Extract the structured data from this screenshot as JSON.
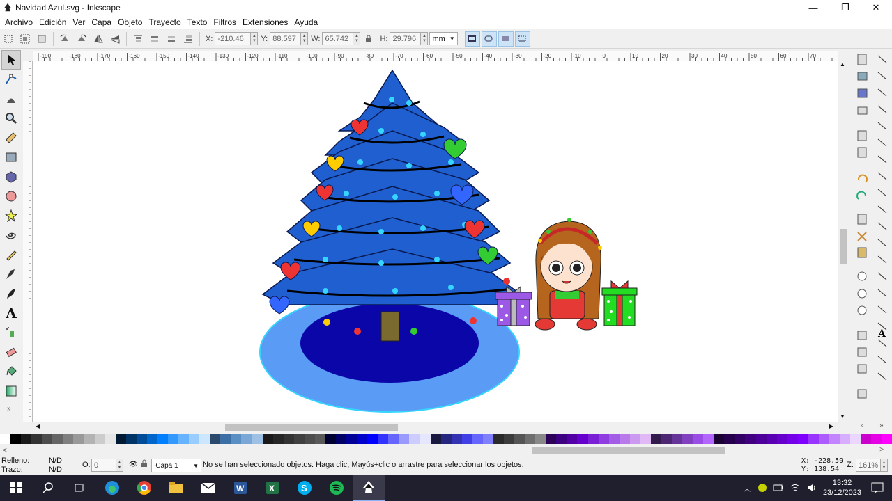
{
  "window": {
    "title": "Navidad Azul.svg - Inkscape",
    "minimize": "—",
    "maximize": "❐",
    "close": "✕"
  },
  "menu": [
    "Archivo",
    "Edición",
    "Ver",
    "Capa",
    "Objeto",
    "Trayecto",
    "Texto",
    "Filtros",
    "Extensiones",
    "Ayuda"
  ],
  "controls": {
    "x_label": "X:",
    "x_value": "-210.46",
    "y_label": "Y:",
    "y_value": "88.597",
    "w_label": "W:",
    "w_value": "65.742",
    "h_label": "H:",
    "h_value": "29.796",
    "unit": "mm"
  },
  "ruler_labels": [
    "-190",
    "-180",
    "-170",
    "-160",
    "-150",
    "-140",
    "-130",
    "-120",
    "-110",
    "-100",
    "-90",
    "-80",
    "-70",
    "-60",
    "-50",
    "-40",
    "-30",
    "-20",
    "-10",
    "0",
    "10",
    "20",
    "30",
    "40",
    "50",
    "60",
    "70"
  ],
  "status": {
    "fill_label": "Relleno:",
    "fill_value": "N/D",
    "stroke_label": "Trazo:",
    "stroke_value": "N/D",
    "opacity_label": "O:",
    "opacity_value": "0",
    "layer": "·Capa 1",
    "message": "No se han seleccionado objetos. Haga clic, Mayús+clic o arrastre para seleccionar los objetos.",
    "cursor_x": "X: -228.59",
    "cursor_y": "Y: 138.54",
    "zoom_label": "Z:",
    "zoom_value": "161%"
  },
  "taskbar": {
    "time": "13:32",
    "date": "23/12/2023"
  },
  "palette_colors": [
    "#ffffff",
    "#000000",
    "#1a1a1a",
    "#333333",
    "#4d4d4d",
    "#666666",
    "#808080",
    "#999999",
    "#b3b3b3",
    "#cccccc",
    "#e6e6e6",
    "#001a33",
    "#003366",
    "#004c99",
    "#0066cc",
    "#0080ff",
    "#3399ff",
    "#66b3ff",
    "#99ccff",
    "#cce6ff",
    "#2b4a6b",
    "#3a6ea5",
    "#5a8fc4",
    "#7aa7d6",
    "#9ec0e4",
    "#1a1a1a",
    "#262626",
    "#333333",
    "#404040",
    "#4d4d4d",
    "#595959",
    "#000033",
    "#000066",
    "#000099",
    "#0000cc",
    "#0000ff",
    "#3333ff",
    "#6666ff",
    "#9999ff",
    "#ccccff",
    "#e6e6ff",
    "#1a1a40",
    "#262680",
    "#3333b3",
    "#4040e6",
    "#6666ff",
    "#8080ff",
    "#2a2a2a",
    "#3c3c3c",
    "#555555",
    "#6e6e6e",
    "#888888",
    "#2d0059",
    "#3d0080",
    "#5200a6",
    "#6600cc",
    "#7a1fd6",
    "#8f3de0",
    "#a35ce6",
    "#b87aeb",
    "#cc99f0",
    "#e0b8f5",
    "#331a4d",
    "#4d2673",
    "#663399",
    "#8040bf",
    "#994ce6",
    "#b366ff",
    "#1a0033",
    "#26004d",
    "#330066",
    "#400080",
    "#4c0099",
    "#5900b3",
    "#6600cc",
    "#7300e6",
    "#8000ff",
    "#9933ff",
    "#ad5cff",
    "#c285ff",
    "#d6adff",
    "#ebd6ff",
    "#cc00cc",
    "#e600e6",
    "#ff00ff"
  ]
}
